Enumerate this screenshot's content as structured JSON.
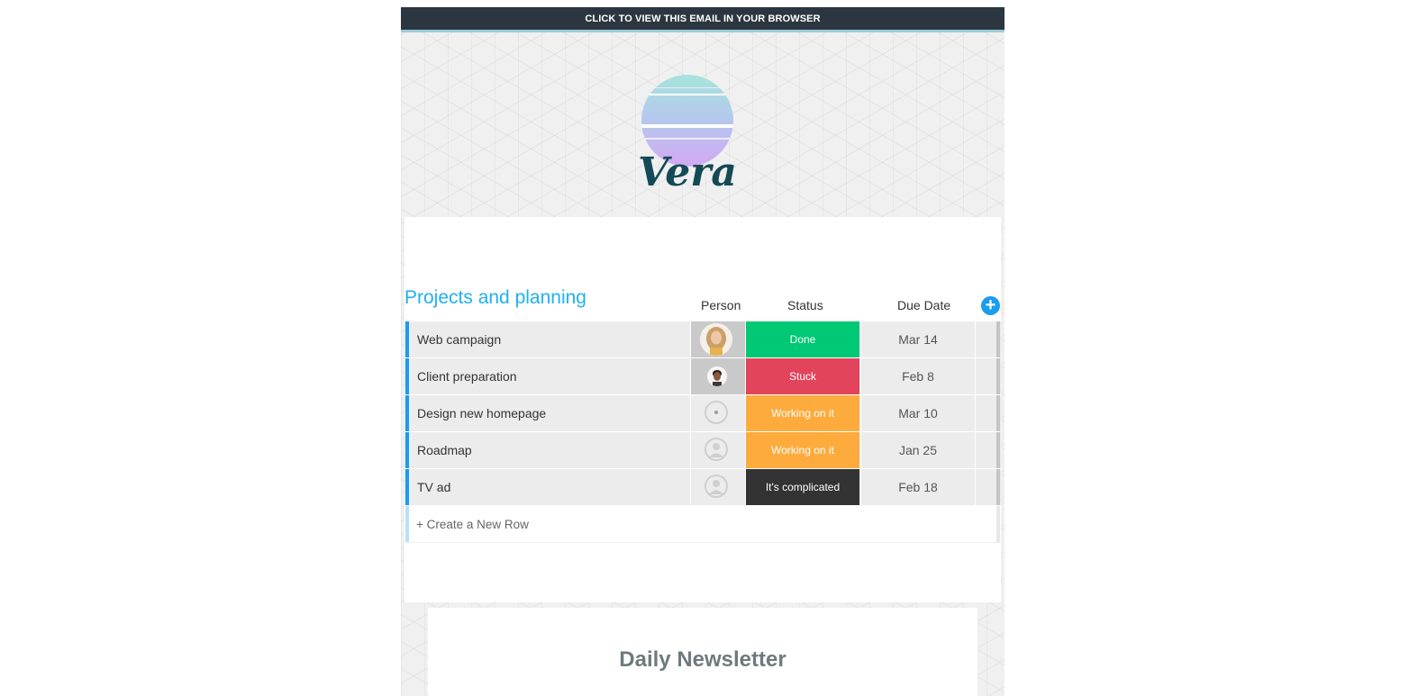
{
  "topbar": {
    "label": "CLICK TO VIEW THIS EMAIL IN YOUR BROWSER"
  },
  "logo": {
    "text": "Vera",
    "text_color": "#134a55"
  },
  "board": {
    "title": "Projects and planning",
    "columns": {
      "person": "Person",
      "status": "Status",
      "due": "Due Date"
    },
    "add_icon": "plus-circle-icon",
    "rows": [
      {
        "name": "Web campaign",
        "person": "woman-avatar",
        "status": "Done",
        "status_color": "#00c875",
        "due": "Mar 14"
      },
      {
        "name": "Client preparation",
        "person": "man-avatar",
        "status": "Stuck",
        "status_color": "#e2445c",
        "due": "Feb 8"
      },
      {
        "name": "Design new homepage",
        "person": "empty-user-icon",
        "status": "Working on it",
        "status_color": "#fdab3d",
        "due": "Mar 10"
      },
      {
        "name": "Roadmap",
        "person": "empty-user-icon",
        "status": "Working on it",
        "status_color": "#fdab3d",
        "due": "Jan 25"
      },
      {
        "name": "TV ad",
        "person": "empty-user-icon",
        "status": "It's complicated",
        "status_color": "#333333",
        "due": "Feb 18"
      }
    ],
    "new_row": "+ Create a New Row"
  },
  "newsletter": {
    "title": "Daily Newsletter"
  }
}
